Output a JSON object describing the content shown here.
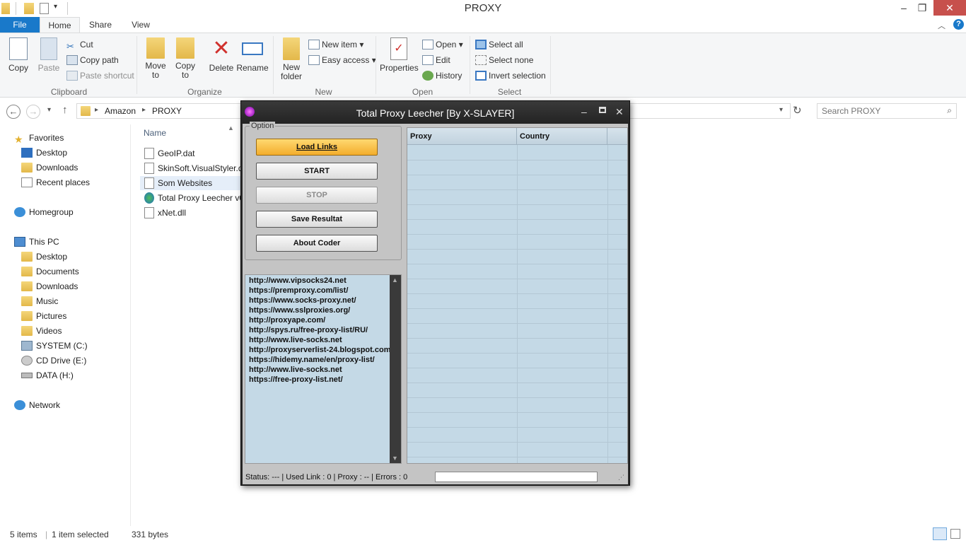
{
  "window": {
    "title": "PROXY"
  },
  "ribbon": {
    "tabs": {
      "file": "File",
      "home": "Home",
      "share": "Share",
      "view": "View"
    },
    "clipboard": {
      "label": "Clipboard",
      "copy": "Copy",
      "paste": "Paste",
      "cut": "Cut",
      "copy_path": "Copy path",
      "paste_shortcut": "Paste shortcut"
    },
    "organize": {
      "label": "Organize",
      "move_to": "Move to",
      "copy_to": "Copy to",
      "delete": "Delete",
      "rename": "Rename"
    },
    "new": {
      "label": "New",
      "new_folder": "New folder",
      "new_item": "New item",
      "easy_access": "Easy access"
    },
    "open": {
      "label": "Open",
      "properties": "Properties",
      "open": "Open",
      "edit": "Edit",
      "history": "History"
    },
    "select": {
      "label": "Select",
      "select_all": "Select all",
      "select_none": "Select none",
      "invert_selection": "Invert selection"
    }
  },
  "address": {
    "breadcrumb": [
      "Amazon",
      "PROXY"
    ],
    "search_placeholder": "Search PROXY"
  },
  "nav": {
    "favorites": "Favorites",
    "favorites_items": [
      "Desktop",
      "Downloads",
      "Recent places"
    ],
    "homegroup": "Homegroup",
    "this_pc": "This PC",
    "pc_items": [
      "Desktop",
      "Documents",
      "Downloads",
      "Music",
      "Pictures",
      "Videos",
      "SYSTEM (C:)",
      "CD Drive (E:)",
      "DATA (H:)"
    ],
    "network": "Network"
  },
  "files": {
    "column_name": "Name",
    "items": [
      "GeoIP.dat",
      "SkinSoft.VisualStyler.dl",
      "Som Websites",
      "Total Proxy Leecher v0",
      "xNet.dll"
    ]
  },
  "statusbar": {
    "items": "5 items",
    "selected": "1 item selected",
    "size": "331 bytes"
  },
  "app": {
    "title": "Total Proxy Leecher [By X-SLAYER]",
    "option_label": "Option",
    "buttons": {
      "load": "Load Links",
      "start": "START",
      "stop": "STOP",
      "save": "Save Resultat",
      "about": "About Coder"
    },
    "links": [
      "http://www.vipsocks24.net",
      "https://premproxy.com/list/",
      "https://www.socks-proxy.net/",
      "https://www.sslproxies.org/",
      "http://proxyape.com/",
      "http://spys.ru/free-proxy-list/RU/",
      "http://www.live-socks.net",
      "http://proxyserverlist-24.blogspot.com",
      "https://hidemy.name/en/proxy-list/",
      "http://www.live-socks.net",
      "https://free-proxy-list.net/"
    ],
    "grid_columns": {
      "proxy": "Proxy",
      "country": "Country"
    },
    "status_text": "Status: ---  |  Used Link : 0  |  Proxy : --  |  Errors : 0"
  }
}
